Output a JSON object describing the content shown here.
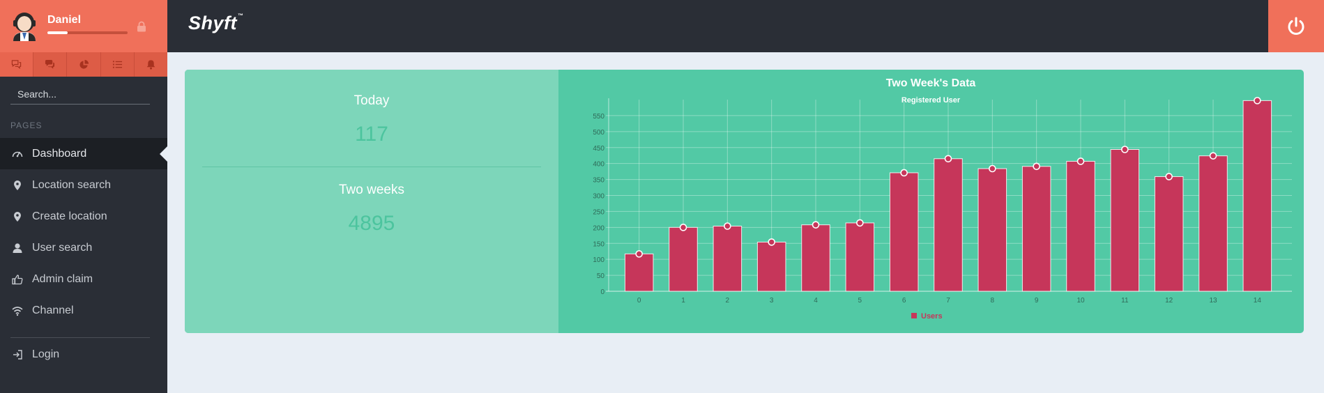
{
  "user": {
    "name": "Daniel",
    "progress_percent": 25
  },
  "user_tabs": [
    {
      "icon": "chat-bubbles-outline-icon"
    },
    {
      "icon": "comments-icon"
    },
    {
      "icon": "pie-chart-icon"
    },
    {
      "icon": "list-icon"
    },
    {
      "icon": "bell-icon"
    }
  ],
  "search": {
    "placeholder": "Search..."
  },
  "sidebar": {
    "section_label": "PAGES",
    "items": [
      {
        "label": "Dashboard",
        "icon": "speedometer-icon",
        "active": true
      },
      {
        "label": "Location search",
        "icon": "map-marker-icon"
      },
      {
        "label": "Create location",
        "icon": "map-marker-icon"
      },
      {
        "label": "User search",
        "icon": "user-icon"
      },
      {
        "label": "Admin claim",
        "icon": "thumbs-up-icon"
      },
      {
        "label": "Channel",
        "icon": "wifi-icon"
      }
    ],
    "login": {
      "label": "Login",
      "icon": "sign-in-icon"
    }
  },
  "header": {
    "brand": "Shyft",
    "brand_mark": "™"
  },
  "stats": {
    "today_label": "Today",
    "today_value": "117",
    "two_weeks_label": "Two weeks",
    "two_weeks_value": "4895"
  },
  "colors": {
    "accent": "#f0705a",
    "sidebar": "#2a2e36",
    "panel_light": "#7dd6ba",
    "panel": "#52c9a5",
    "bar": "#c6365a"
  },
  "chart_data": {
    "type": "bar",
    "title": "Two Week's Data",
    "subtitle": "Registered User",
    "xlabel": "",
    "ylabel": "",
    "categories": [
      "0",
      "1",
      "2",
      "3",
      "4",
      "5",
      "6",
      "7",
      "8",
      "9",
      "10",
      "11",
      "12",
      "13",
      "14"
    ],
    "series": [
      {
        "name": "Users",
        "values": [
          117,
          200,
          204,
          154,
          208,
          214,
          371,
          415,
          384,
          391,
          407,
          444,
          359,
          424,
          597
        ]
      }
    ],
    "ylim": [
      0,
      600
    ],
    "yticks": [
      0,
      50,
      100,
      150,
      200,
      250,
      300,
      350,
      400,
      450,
      500,
      550
    ],
    "grid": true,
    "legend_position": "bottom"
  }
}
